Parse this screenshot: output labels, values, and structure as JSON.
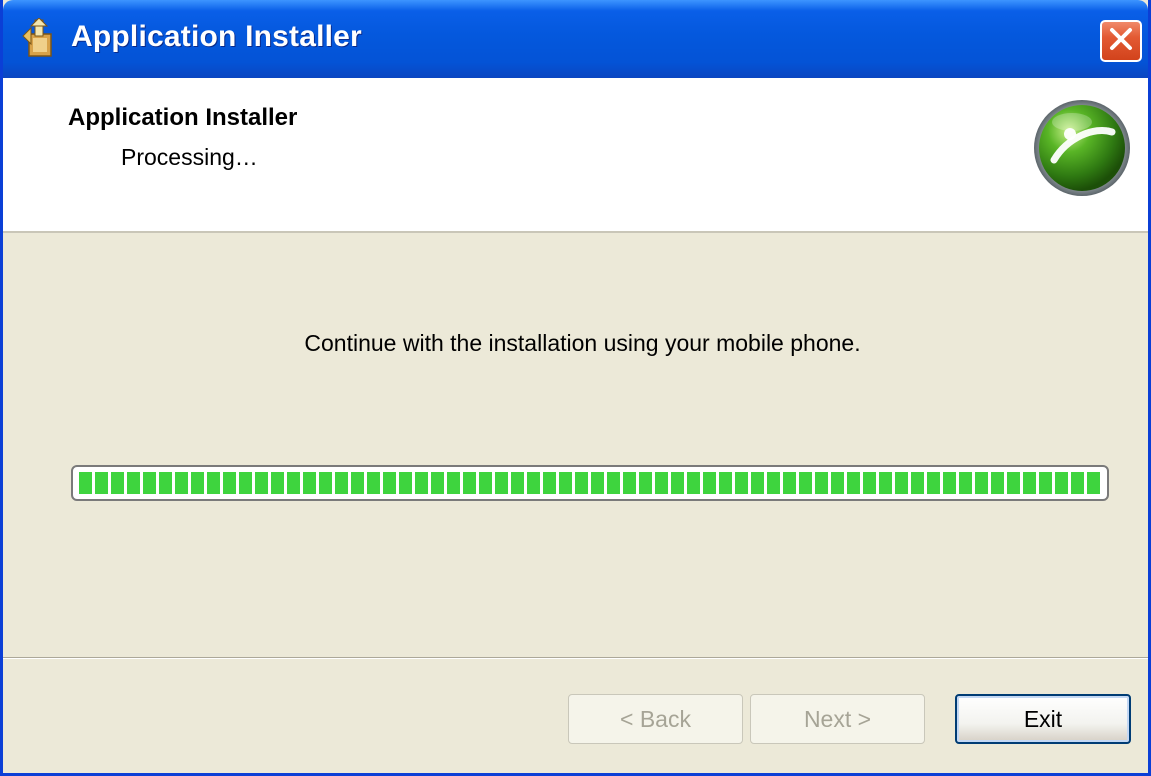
{
  "window": {
    "title": "Application Installer",
    "close_icon": "close-x-icon",
    "app_icon": "installer-icon"
  },
  "header": {
    "title": "Application Installer",
    "subtitle": "Processing…",
    "logo_icon": "sony-ericsson-logo"
  },
  "body": {
    "message": "Continue with the installation using your mobile phone.",
    "progress_fraction": 1.0
  },
  "buttons": {
    "back_label": "< Back",
    "next_label": "Next >",
    "exit_label": "Exit"
  },
  "colors": {
    "titlebar": "#0458dd",
    "progress_green": "#3ed43e",
    "close_red": "#e35a33",
    "dialog_bg": "#ece9d8"
  }
}
